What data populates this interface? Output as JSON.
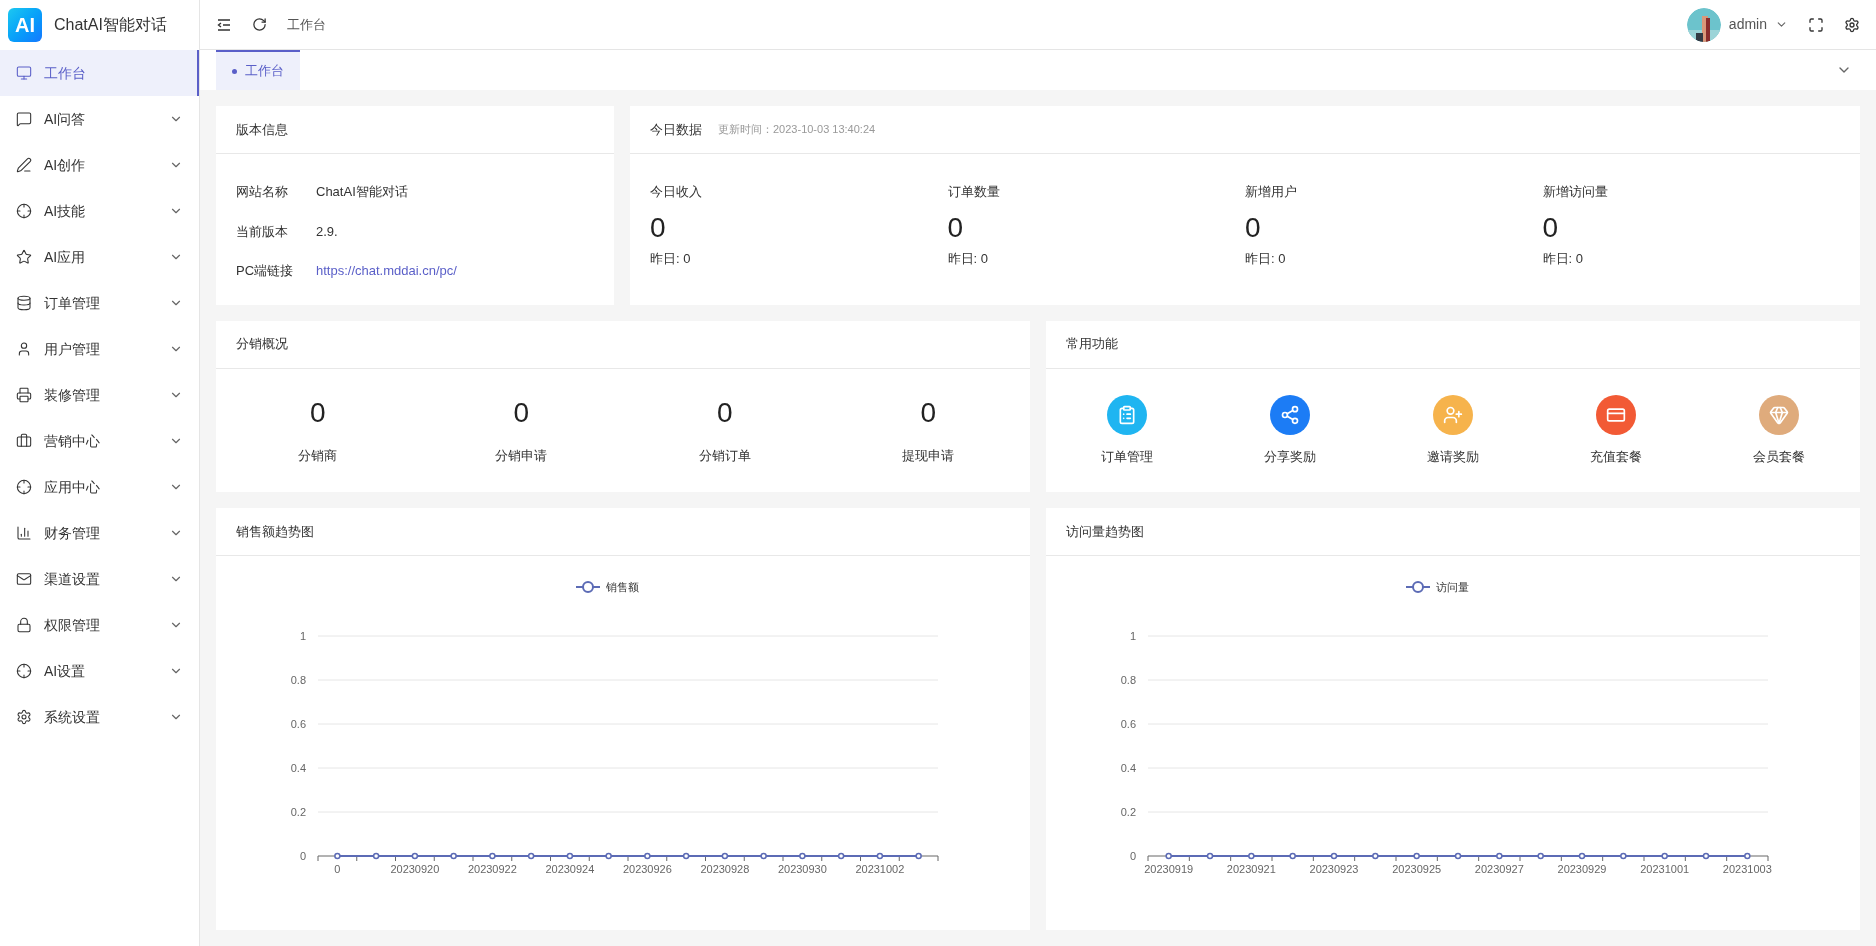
{
  "logo": {
    "mark": "AI",
    "title": "ChatAI智能对话"
  },
  "sidebar": {
    "items": [
      {
        "label": "工作台",
        "kind": "link",
        "selected": true
      },
      {
        "label": "AI问答",
        "kind": "submenu",
        "selected": false
      },
      {
        "label": "AI创作",
        "kind": "submenu",
        "selected": false
      },
      {
        "label": "AI技能",
        "kind": "submenu",
        "selected": false
      },
      {
        "label": "AI应用",
        "kind": "submenu",
        "selected": false
      },
      {
        "label": "订单管理",
        "kind": "submenu",
        "selected": false
      },
      {
        "label": "用户管理",
        "kind": "submenu",
        "selected": false
      },
      {
        "label": "装修管理",
        "kind": "submenu",
        "selected": false
      },
      {
        "label": "营销中心",
        "kind": "submenu",
        "selected": false
      },
      {
        "label": "应用中心",
        "kind": "submenu",
        "selected": false
      },
      {
        "label": "财务管理",
        "kind": "submenu",
        "selected": false
      },
      {
        "label": "渠道设置",
        "kind": "submenu",
        "selected": false
      },
      {
        "label": "权限管理",
        "kind": "submenu",
        "selected": false
      },
      {
        "label": "AI设置",
        "kind": "submenu",
        "selected": false
      },
      {
        "label": "系统设置",
        "kind": "submenu",
        "selected": false
      }
    ]
  },
  "header": {
    "breadcrumb": "工作台",
    "user": "admin"
  },
  "tabs": [
    {
      "label": "工作台",
      "selected": true
    }
  ],
  "version_card": {
    "title": "版本信息",
    "rows": [
      {
        "label": "网站名称",
        "value": "ChatAI智能对话",
        "kind": "text"
      },
      {
        "label": "当前版本",
        "value": "2.9.",
        "kind": "text"
      },
      {
        "label": "PC端链接",
        "value": "https://chat.mddai.cn/pc/",
        "kind": "link"
      }
    ]
  },
  "today_card": {
    "title": "今日数据",
    "updated": "更新时间：2023-10-03 13:40:24",
    "stats": [
      {
        "label": "今日收入",
        "value": "0",
        "yesterday": "昨日: 0"
      },
      {
        "label": "订单数量",
        "value": "0",
        "yesterday": "昨日: 0"
      },
      {
        "label": "新增用户",
        "value": "0",
        "yesterday": "昨日: 0"
      },
      {
        "label": "新增访问量",
        "value": "0",
        "yesterday": "昨日: 0"
      }
    ]
  },
  "distribution_card": {
    "title": "分销概况",
    "stats": [
      {
        "value": "0",
        "label": "分销商"
      },
      {
        "value": "0",
        "label": "分销申请"
      },
      {
        "value": "0",
        "label": "分销订单"
      },
      {
        "value": "0",
        "label": "提现申请"
      }
    ]
  },
  "functions_card": {
    "title": "常用功能",
    "items": [
      {
        "label": "订单管理",
        "color": "#1fb5f1"
      },
      {
        "label": "分享奖励",
        "color": "#1c7cf5"
      },
      {
        "label": "邀请奖励",
        "color": "#f6b34c"
      },
      {
        "label": "充值套餐",
        "color": "#f25a35"
      },
      {
        "label": "会员套餐",
        "color": "#dfab7c"
      }
    ]
  },
  "sales_chart": {
    "title": "销售额趋势图",
    "chart_data": {
      "type": "line",
      "categories": [
        "0",
        null,
        "20230920",
        null,
        "20230922",
        null,
        "20230924",
        null,
        "20230926",
        null,
        "20230928",
        null,
        "20230930",
        null,
        "20231002",
        null
      ],
      "series": [
        {
          "name": "销售额",
          "color": "#5c6bb5",
          "marker": true,
          "values": [
            0,
            0,
            0,
            0,
            0,
            0,
            0,
            0,
            0,
            0,
            0,
            0,
            0,
            0,
            0,
            0
          ]
        }
      ],
      "ylim": [
        0,
        1
      ],
      "yticks": [
        0,
        0.2,
        0.4,
        0.6,
        0.8,
        1
      ],
      "grid": true
    }
  },
  "visits_chart": {
    "title": "访问量趋势图",
    "chart_data": {
      "type": "line",
      "categories": [
        "20230919",
        null,
        "20230921",
        null,
        "20230923",
        null,
        "20230925",
        null,
        "20230927",
        null,
        "20230929",
        null,
        "20231001",
        null,
        "20231003"
      ],
      "series": [
        {
          "name": "访问量",
          "color": "#5c6bb5",
          "marker": true,
          "values": [
            0,
            0,
            0,
            0,
            0,
            0,
            0,
            0,
            0,
            0,
            0,
            0,
            0,
            0,
            0
          ]
        }
      ],
      "ylim": [
        0,
        1
      ],
      "yticks": [
        0,
        0.2,
        0.4,
        0.6,
        0.8,
        1
      ],
      "grid": true
    }
  }
}
